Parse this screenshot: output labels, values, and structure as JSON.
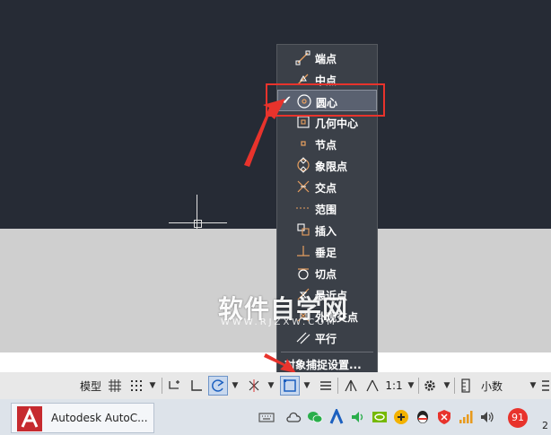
{
  "snap_menu": {
    "items": [
      {
        "label": "端点",
        "checked": false,
        "icon": "endpoint-icon"
      },
      {
        "label": "中点",
        "checked": false,
        "icon": "midpoint-icon"
      },
      {
        "label": "圆心",
        "checked": true,
        "icon": "center-icon"
      },
      {
        "label": "几何中心",
        "checked": false,
        "icon": "geometric-center-icon"
      },
      {
        "label": "节点",
        "checked": false,
        "icon": "node-icon"
      },
      {
        "label": "象限点",
        "checked": false,
        "icon": "quadrant-icon"
      },
      {
        "label": "交点",
        "checked": false,
        "icon": "intersection-icon"
      },
      {
        "label": "范围",
        "checked": false,
        "icon": "extension-icon"
      },
      {
        "label": "插入",
        "checked": false,
        "icon": "insertion-icon"
      },
      {
        "label": "垂足",
        "checked": false,
        "icon": "perpendicular-icon"
      },
      {
        "label": "切点",
        "checked": false,
        "icon": "tangent-icon"
      },
      {
        "label": "最近点",
        "checked": false,
        "icon": "nearest-icon"
      },
      {
        "label": "外观交点",
        "checked": false,
        "icon": "apparent-intersection-icon"
      },
      {
        "label": "平行",
        "checked": false,
        "icon": "parallel-icon"
      }
    ],
    "check_glyph": "✔",
    "settings_label": "对象捕捉设置..."
  },
  "watermark": {
    "text": "软件自学网",
    "sub": "WWW.RJZXW.COM"
  },
  "status_bar": {
    "model_label": "模型",
    "scale_label": "1:1",
    "units_label": "小数",
    "dropdown_glyph": "▼"
  },
  "taskbar": {
    "app_label": "Autodesk AutoC...",
    "notification_count": "91",
    "clock_fragment": "2"
  },
  "colors": {
    "canvas": "#262b35",
    "menu_bg": "#3b4048",
    "icon_orange": "#e8a060",
    "highlight_red": "#e8332c",
    "status_active": "#6c93c8"
  }
}
